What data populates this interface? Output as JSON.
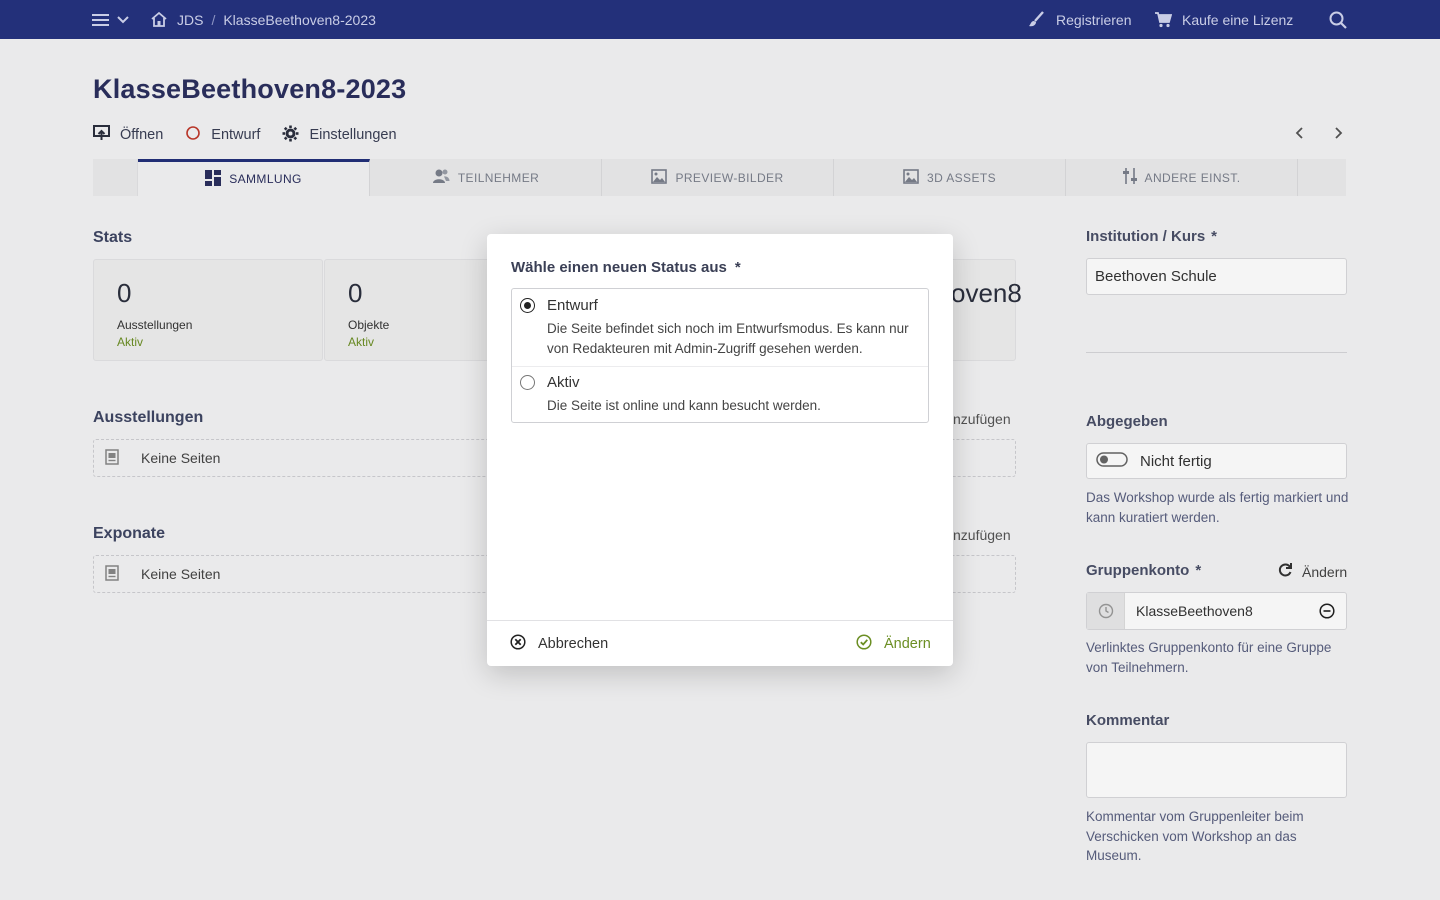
{
  "topbar": {
    "breadcrumb": [
      "JDS",
      "KlasseBeethoven8-2023"
    ],
    "separator": "/",
    "register_label": "Registrieren",
    "license_label": "Kaufe eine Lizenz"
  },
  "page": {
    "title": "KlasseBeethoven8-2023",
    "actions": {
      "open_label": "Öffnen",
      "status_label": "Entwurf",
      "settings_label": "Einstellungen"
    }
  },
  "tabs": [
    {
      "label": "SAMMLUNG",
      "icon": "grid-icon",
      "active": true
    },
    {
      "label": "TEILNEHMER",
      "icon": "users-icon",
      "active": false
    },
    {
      "label": "PREVIEW-BILDER",
      "icon": "image-icon",
      "active": false
    },
    {
      "label": "3D ASSETS",
      "icon": "image-icon",
      "active": false
    },
    {
      "label": "ANDERE EINST.",
      "icon": "sliders-icon",
      "active": false
    }
  ],
  "stats": {
    "title": "Stats",
    "cards": [
      {
        "value": "0",
        "label": "Ausstellungen",
        "status": "Aktiv"
      },
      {
        "value": "0",
        "label": "Objekte",
        "status": "Aktiv"
      }
    ],
    "partial_card_text": "oven8"
  },
  "exhibitions": {
    "title": "Ausstellungen",
    "empty": "Keine Seiten",
    "add_partial": "nzufügen"
  },
  "exhibits": {
    "title": "Exponate",
    "empty": "Keine Seiten",
    "add_partial": "nzufügen"
  },
  "sidebar": {
    "institution": {
      "label": "Institution / Kurs",
      "required": "*",
      "value": "Beethoven Schule"
    },
    "submitted": {
      "label": "Abgegeben",
      "toggle_label": "Nicht fertig",
      "help": "Das Workshop wurde als fertig markiert und kann kuratiert werden."
    },
    "group": {
      "label": "Gruppenkonto",
      "required": "*",
      "change_label": "Ändern",
      "value": "KlasseBeethoven8",
      "help": "Verlinktes Gruppenkonto für eine Gruppe von Teilnehmern."
    },
    "comment": {
      "label": "Kommentar",
      "value": "",
      "help": "Kommentar vom Gruppenleiter beim Verschicken vom Workshop an das Museum."
    }
  },
  "modal": {
    "title": "Wähle einen neuen Status aus",
    "required": "*",
    "options": [
      {
        "label": "Entwurf",
        "description": "Die Seite befindet sich noch im Entwurfsmodus. Es kann nur von Redakteuren mit Admin-Zugriff gesehen werden.",
        "checked": true
      },
      {
        "label": "Aktiv",
        "description": "Die Seite ist online und kann besucht werden.",
        "checked": false
      }
    ],
    "cancel_label": "Abbrechen",
    "confirm_label": "Ändern"
  },
  "colors": {
    "topbar": "#23307a",
    "accent_green": "#6b8e23",
    "status_red": "#c0392b"
  }
}
